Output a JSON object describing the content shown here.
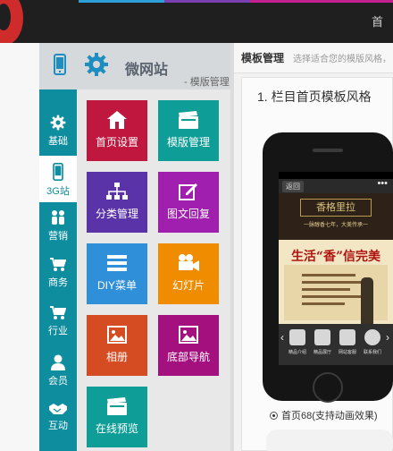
{
  "colors": {
    "topbar": "#1f1f1f",
    "sidebar": "#0e8d9f",
    "tile_red": "#c0173f",
    "tile_teal": "#0f9e97",
    "tile_purple": "#5a33a8",
    "tile_magenta": "#a11faf",
    "tile_blue": "#2f8fd8",
    "tile_orange": "#f08c00",
    "tile_darkorange": "#d54b22",
    "tile_darkmagenta": "#a4107e"
  },
  "topbar": {
    "nav_first": "首"
  },
  "header": {
    "title": "微网站",
    "subtitle": "- 模版管理"
  },
  "sidebar": {
    "items": [
      {
        "label": "基础",
        "icon": "gear-icon"
      },
      {
        "label": "3G站",
        "icon": "phone-icon"
      },
      {
        "label": "营销",
        "icon": "users-icon"
      },
      {
        "label": "商务",
        "icon": "cart-icon"
      },
      {
        "label": "行业",
        "icon": "cart-icon"
      },
      {
        "label": "会员",
        "icon": "user-icon"
      },
      {
        "label": "互动",
        "icon": "handshake-icon"
      }
    ],
    "active_index": 1
  },
  "tiles": [
    {
      "label": "首页设置",
      "icon": "home-icon"
    },
    {
      "label": "模版管理",
      "icon": "film-icon"
    },
    {
      "label": "分类管理",
      "icon": "sitemap-icon"
    },
    {
      "label": "图文回复",
      "icon": "edit-icon"
    },
    {
      "label": "DIY菜单",
      "icon": "menu-icon"
    },
    {
      "label": "幻灯片",
      "icon": "video-camera-icon"
    },
    {
      "label": "相册",
      "icon": "picture-icon"
    },
    {
      "label": "底部导航",
      "icon": "picture-icon"
    },
    {
      "label": "在线预览",
      "icon": "film-icon"
    }
  ],
  "right_panel": {
    "title": "模板管理",
    "description": "选择适合您的模版风格，",
    "section_title": "1. 栏目首页模板风格",
    "template_option": "首页68(支持动画效果)"
  },
  "phone_preview": {
    "back_label": "返回",
    "dots": "•••",
    "brand": "香格里拉",
    "tagline": "一脉醇香七年，大美传承一",
    "slogan": "生活“香”信完美",
    "icon_labels": [
      "精品介绍",
      "精品展厅",
      "网站客服",
      "联系我们"
    ]
  }
}
